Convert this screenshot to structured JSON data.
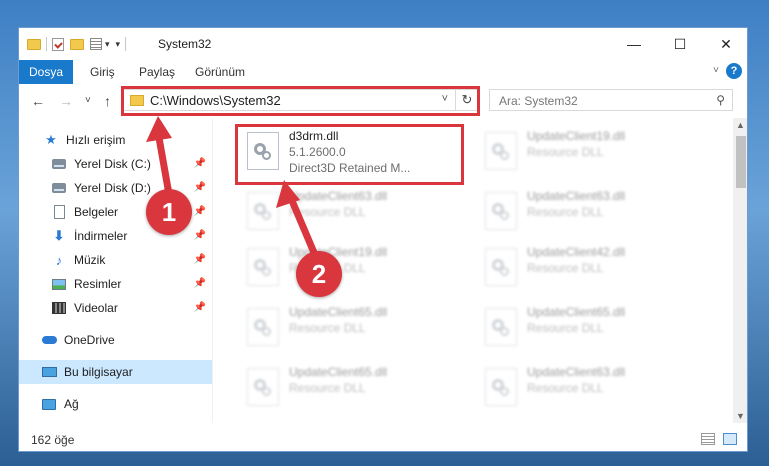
{
  "window": {
    "title": "System32"
  },
  "ribbon": {
    "tabs": [
      "Dosya",
      "Giriş",
      "Paylaş",
      "Görünüm"
    ]
  },
  "navbar": {
    "path": "C:\\Windows\\System32",
    "search_placeholder": "Ara: System32"
  },
  "sidebar": {
    "items": [
      {
        "label": "Hızlı erişim",
        "icon": "star-icon"
      },
      {
        "label": "Yerel Disk (C:)",
        "icon": "drive-icon"
      },
      {
        "label": "Yerel Disk (D:)",
        "icon": "drive-icon"
      },
      {
        "label": "Belgeler",
        "icon": "documents-icon"
      },
      {
        "label": "İndirmeler",
        "icon": "download-icon"
      },
      {
        "label": "Müzik",
        "icon": "music-icon"
      },
      {
        "label": "Resimler",
        "icon": "pictures-icon"
      },
      {
        "label": "Videolar",
        "icon": "videos-icon"
      },
      {
        "label": "OneDrive",
        "icon": "cloud-icon"
      },
      {
        "label": "Bu bilgisayar",
        "icon": "computer-icon"
      },
      {
        "label": "Ağ",
        "icon": "network-icon"
      }
    ]
  },
  "files": {
    "highlighted": {
      "name": "d3drm.dll",
      "version": "5.1.2600.0",
      "description": "Direct3D Retained M..."
    },
    "left": [
      {
        "name": "UpdateClient63.dll",
        "type": "Resource DLL"
      },
      {
        "name": "UpdateClient19.dll",
        "type": "Resource DLL"
      },
      {
        "name": "UpdateClient65.dll",
        "type": "Resource DLL"
      },
      {
        "name": "UpdateClient65.dll",
        "type": "Resource DLL"
      }
    ],
    "right": [
      {
        "name": "UpdateClient19.dll",
        "type": "Resource DLL"
      },
      {
        "name": "UpdateClient63.dll",
        "type": "Resource DLL"
      },
      {
        "name": "UpdateClient42.dll",
        "type": "Resource DLL"
      },
      {
        "name": "UpdateClient65.dll",
        "type": "Resource DLL"
      },
      {
        "name": "UpdateClient63.dll",
        "type": "Resource DLL"
      }
    ]
  },
  "status": {
    "count": "162 öğe"
  },
  "annotations": {
    "step1": "1",
    "step2": "2"
  },
  "colors": {
    "accent": "#1979ca",
    "annotation": "#d9363e",
    "selection": "#cce8ff"
  }
}
